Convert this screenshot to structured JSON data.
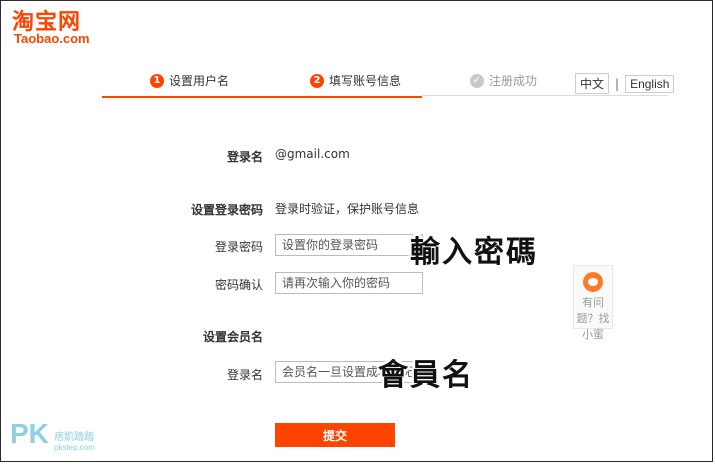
{
  "logo": {
    "cn": "淘宝网",
    "en": "Taobao.com"
  },
  "steps": [
    {
      "num": "1",
      "label": "设置用户名"
    },
    {
      "num": "2",
      "label": "填写账号信息"
    },
    {
      "num": "✓",
      "label": "注册成功"
    }
  ],
  "lang": {
    "zh": "中文",
    "sep": "|",
    "en": "English"
  },
  "form": {
    "login_name_label": "登录名",
    "login_name_value": "@gmail.com",
    "password_section_label": "设置登录密码",
    "password_section_hint": "登录时验证，保护账号信息",
    "password_label": "登录密码",
    "password_placeholder": "设置你的登录密码",
    "confirm_label": "密码确认",
    "confirm_placeholder": "请再次输入你的密码",
    "member_section_label": "设置会员名",
    "member_label": "登录名",
    "member_placeholder": "会员名一旦设置成功，无法修改",
    "submit_label": "提交"
  },
  "annotations": {
    "password": "輸入密碼",
    "member": "會員名"
  },
  "help": {
    "text": "有问题？找小蜜"
  },
  "watermark": {
    "big": "PK",
    "small": "痞凱踏踏",
    "url": "pkstep.com"
  },
  "colors": {
    "accent": "#ff4400"
  }
}
